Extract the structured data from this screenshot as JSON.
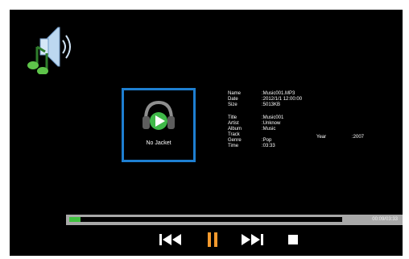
{
  "jacket": {
    "label": "No Jacket"
  },
  "file_info": [
    {
      "key": "Name",
      "value": ":Music001.MP3"
    },
    {
      "key": "Date",
      "value": ":2012/1/1 12:00:00"
    },
    {
      "key": "Size",
      "value": ":5013KB"
    }
  ],
  "tag_info": [
    {
      "key": "Title",
      "value": ":Music001"
    },
    {
      "key": "Artist",
      "value": ":Unknow"
    },
    {
      "key": "Album",
      "value": ":Music"
    },
    {
      "key": "Track",
      "value": ""
    },
    {
      "key": "Genre",
      "value": ":Pop"
    },
    {
      "key": "Time",
      "value": ":03:33"
    }
  ],
  "year": {
    "label": "Year",
    "value": ":2007"
  },
  "progress": {
    "fraction": 0.04,
    "time_text": "00:09/03:33"
  },
  "controls": {
    "prev_icon": "skip-previous-icon",
    "pause_icon": "pause-icon",
    "next_icon": "skip-next-icon",
    "stop_icon": "stop-icon"
  },
  "colors": {
    "accent_border": "#1e7fd1",
    "pause": "#f39a2e",
    "progress_fill": "#3fc13f",
    "icon_green": "#5ec44a"
  }
}
